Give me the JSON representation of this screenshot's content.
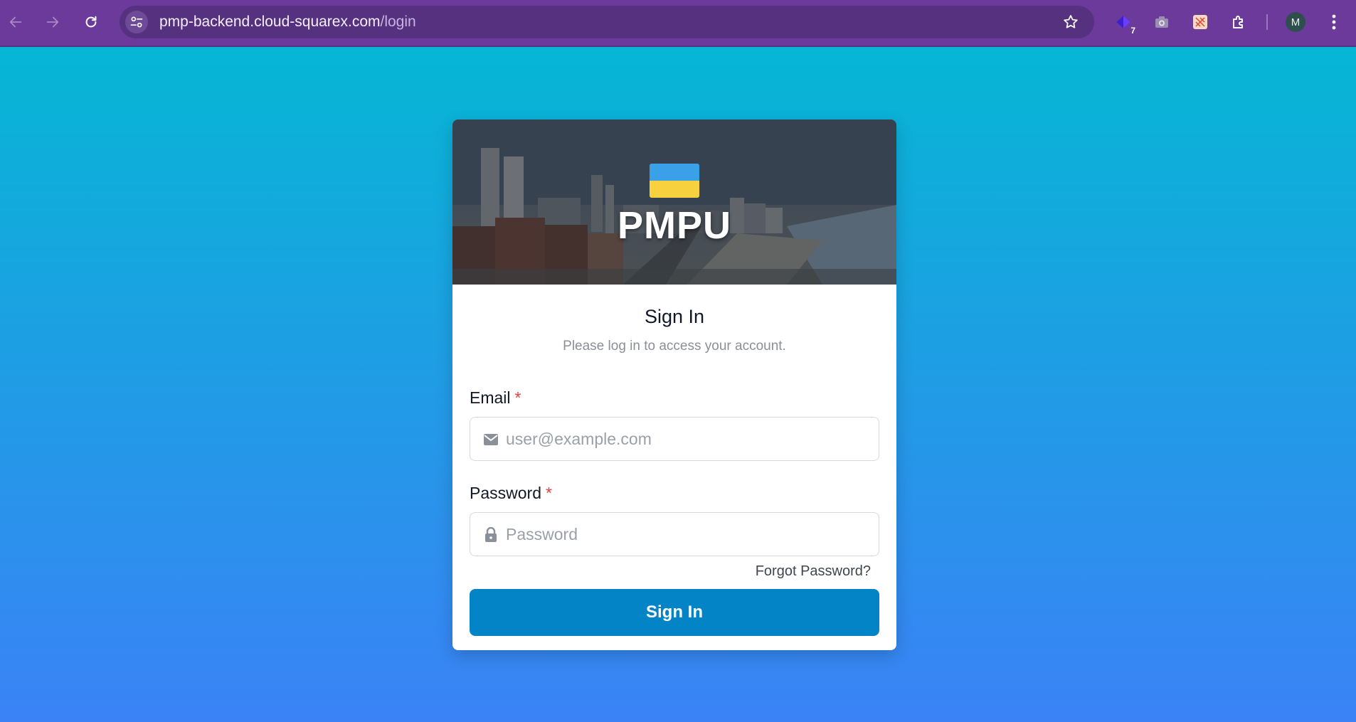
{
  "browser": {
    "url_host": "pmp-backend.cloud-squarex.com",
    "url_path": "/login",
    "extension_badge": "7",
    "profile_initial": "M",
    "theme_color": "#6b3a9a"
  },
  "page": {
    "background_gradient": [
      "#06b6d4",
      "#3b82f6"
    ],
    "hero": {
      "brand": "PMPU",
      "flag_colors": [
        "#3aa0e8",
        "#f7d23e"
      ]
    },
    "title": "Sign In",
    "subtitle": "Please log in to access your account.",
    "email": {
      "label": "Email",
      "required_mark": "*",
      "placeholder": "user@example.com",
      "icon": "mail-icon"
    },
    "password": {
      "label": "Password",
      "required_mark": "*",
      "placeholder": "Password",
      "icon": "lock-icon"
    },
    "forgot_password": "Forgot Password?",
    "submit_label": "Sign In",
    "accent_color": "#0284c7"
  }
}
